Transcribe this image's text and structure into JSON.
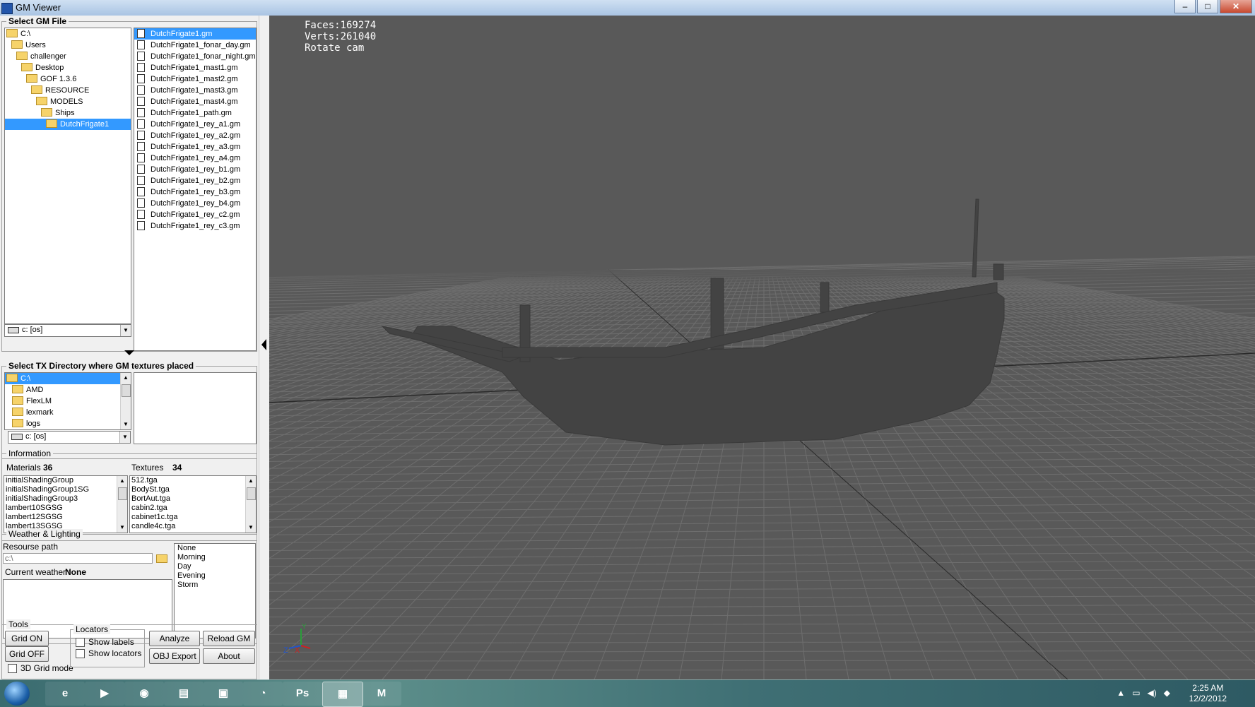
{
  "window": {
    "title": "GM Viewer",
    "min": "–",
    "max": "□",
    "close": "✕"
  },
  "gm_group": {
    "legend": "Select GM File",
    "tree": [
      {
        "label": "C:\\",
        "level": 0
      },
      {
        "label": "Users",
        "level": 1
      },
      {
        "label": "challenger",
        "level": 2
      },
      {
        "label": "Desktop",
        "level": 3
      },
      {
        "label": "GOF 1.3.6",
        "level": 4
      },
      {
        "label": "RESOURCE",
        "level": 5
      },
      {
        "label": "MODELS",
        "level": 6
      },
      {
        "label": "Ships",
        "level": 7
      },
      {
        "label": "DutchFrigate1",
        "level": 8,
        "selected": true
      }
    ],
    "drive": "c: [os]",
    "files": [
      "DutchFrigate1.gm",
      "DutchFrigate1_fonar_day.gm",
      "DutchFrigate1_fonar_night.gm",
      "DutchFrigate1_mast1.gm",
      "DutchFrigate1_mast2.gm",
      "DutchFrigate1_mast3.gm",
      "DutchFrigate1_mast4.gm",
      "DutchFrigate1_path.gm",
      "DutchFrigate1_rey_a1.gm",
      "DutchFrigate1_rey_a2.gm",
      "DutchFrigate1_rey_a3.gm",
      "DutchFrigate1_rey_a4.gm",
      "DutchFrigate1_rey_b1.gm",
      "DutchFrigate1_rey_b2.gm",
      "DutchFrigate1_rey_b3.gm",
      "DutchFrigate1_rey_b4.gm",
      "DutchFrigate1_rey_c2.gm",
      "DutchFrigate1_rey_c3.gm"
    ],
    "selected_file": 0
  },
  "tx_group": {
    "legend": "Select TX Directory where GM textures placed",
    "tree": [
      {
        "label": "C:\\",
        "selected": true
      },
      {
        "label": "AMD"
      },
      {
        "label": "FlexLM"
      },
      {
        "label": "lexmark"
      },
      {
        "label": "logs"
      }
    ],
    "drive": "c: [os]"
  },
  "info": {
    "legend": "Information",
    "materials_label": "Materials",
    "materials_count": "36",
    "textures_label": "Textures",
    "textures_count": "34",
    "materials": [
      "initialShadingGroup",
      "initialShadingGroup1SG",
      "initialShadingGroup3",
      "lambert10SGSG",
      "lambert12SGSG",
      "lambert13SGSG"
    ],
    "textures": [
      "512.tga",
      "BodySt.tga",
      "BortAut.tga",
      "cabin2.tga",
      "cabinet1c.tga",
      "candle4c.tga"
    ]
  },
  "weather": {
    "legend": "Weather & Lighting",
    "resource_label": "Resourse path",
    "resource_value": "c:\\",
    "current_label": "Current weather :",
    "current_value": "None",
    "options": [
      "None",
      "Morning",
      "Day",
      "Evening",
      "Storm"
    ]
  },
  "tools": {
    "legend": "Tools",
    "grid_on": "Grid ON",
    "grid_off": "Grid OFF",
    "grid3d": "3D Grid mode",
    "locators_legend": "Locators",
    "show_labels": "Show labels",
    "show_locators": "Show locators",
    "analyze": "Analyze",
    "reload": "Reload GM",
    "obj_export": "OBJ Export",
    "about": "About"
  },
  "viewport": {
    "faces": "Faces:169274",
    "verts": "Verts:261040",
    "mode": "Rotate cam",
    "axis_z": "Z",
    "axis_x": "X",
    "axis_y": "Y"
  },
  "taskbar": {
    "apps": [
      {
        "name": "ie",
        "glyph": "e"
      },
      {
        "name": "media",
        "glyph": "▶"
      },
      {
        "name": "firefox",
        "glyph": "◉"
      },
      {
        "name": "explorer",
        "glyph": "▤"
      },
      {
        "name": "terminal",
        "glyph": "▣"
      },
      {
        "name": "clock-app",
        "glyph": "◔"
      },
      {
        "name": "photoshop",
        "glyph": "Ps"
      },
      {
        "name": "gmviewer",
        "glyph": "▦"
      },
      {
        "name": "maya",
        "glyph": "M"
      }
    ],
    "time": "2:25 AM",
    "date": "12/2/2012"
  }
}
